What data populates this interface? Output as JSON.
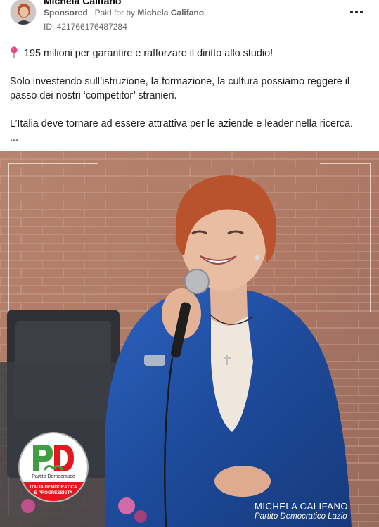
{
  "post": {
    "author": "Michela Califano",
    "sponsored_label": "Sponsored",
    "separator": "·",
    "paid_for_prefix": "Paid for by",
    "paid_for_name": "Michela Califano",
    "ad_id": "ID: 421766176487284",
    "menu_icon": "more-options-icon"
  },
  "content": {
    "pin_icon": "round-pushpin-icon",
    "line1": "195 milioni per garantire e rafforzare il diritto allo studio!",
    "paragraph2": "Solo investendo sull’istruzione, la formazione, la cultura possiamo reggere il passo dei nostri ‘competitor’ stranieri.",
    "paragraph3": "L’Italia deve tornare ad essere attrattiva per le aziende e leader nella ricerca.",
    "ellipsis": "..."
  },
  "media": {
    "logo_party": "Partito Democratico",
    "logo_line1": "ITALIA DEMOCRATICA",
    "logo_line2": "E PROGRESSISTA",
    "caption_name": "MICHELA CALIFANO",
    "caption_party": "Partito Democratico Lazio"
  },
  "colors": {
    "text": "#1c1e21",
    "meta": "#65676b",
    "pd_green": "#3f9e3f",
    "pd_red": "#e3171d",
    "jacket_blue": "#1f4fa0"
  }
}
